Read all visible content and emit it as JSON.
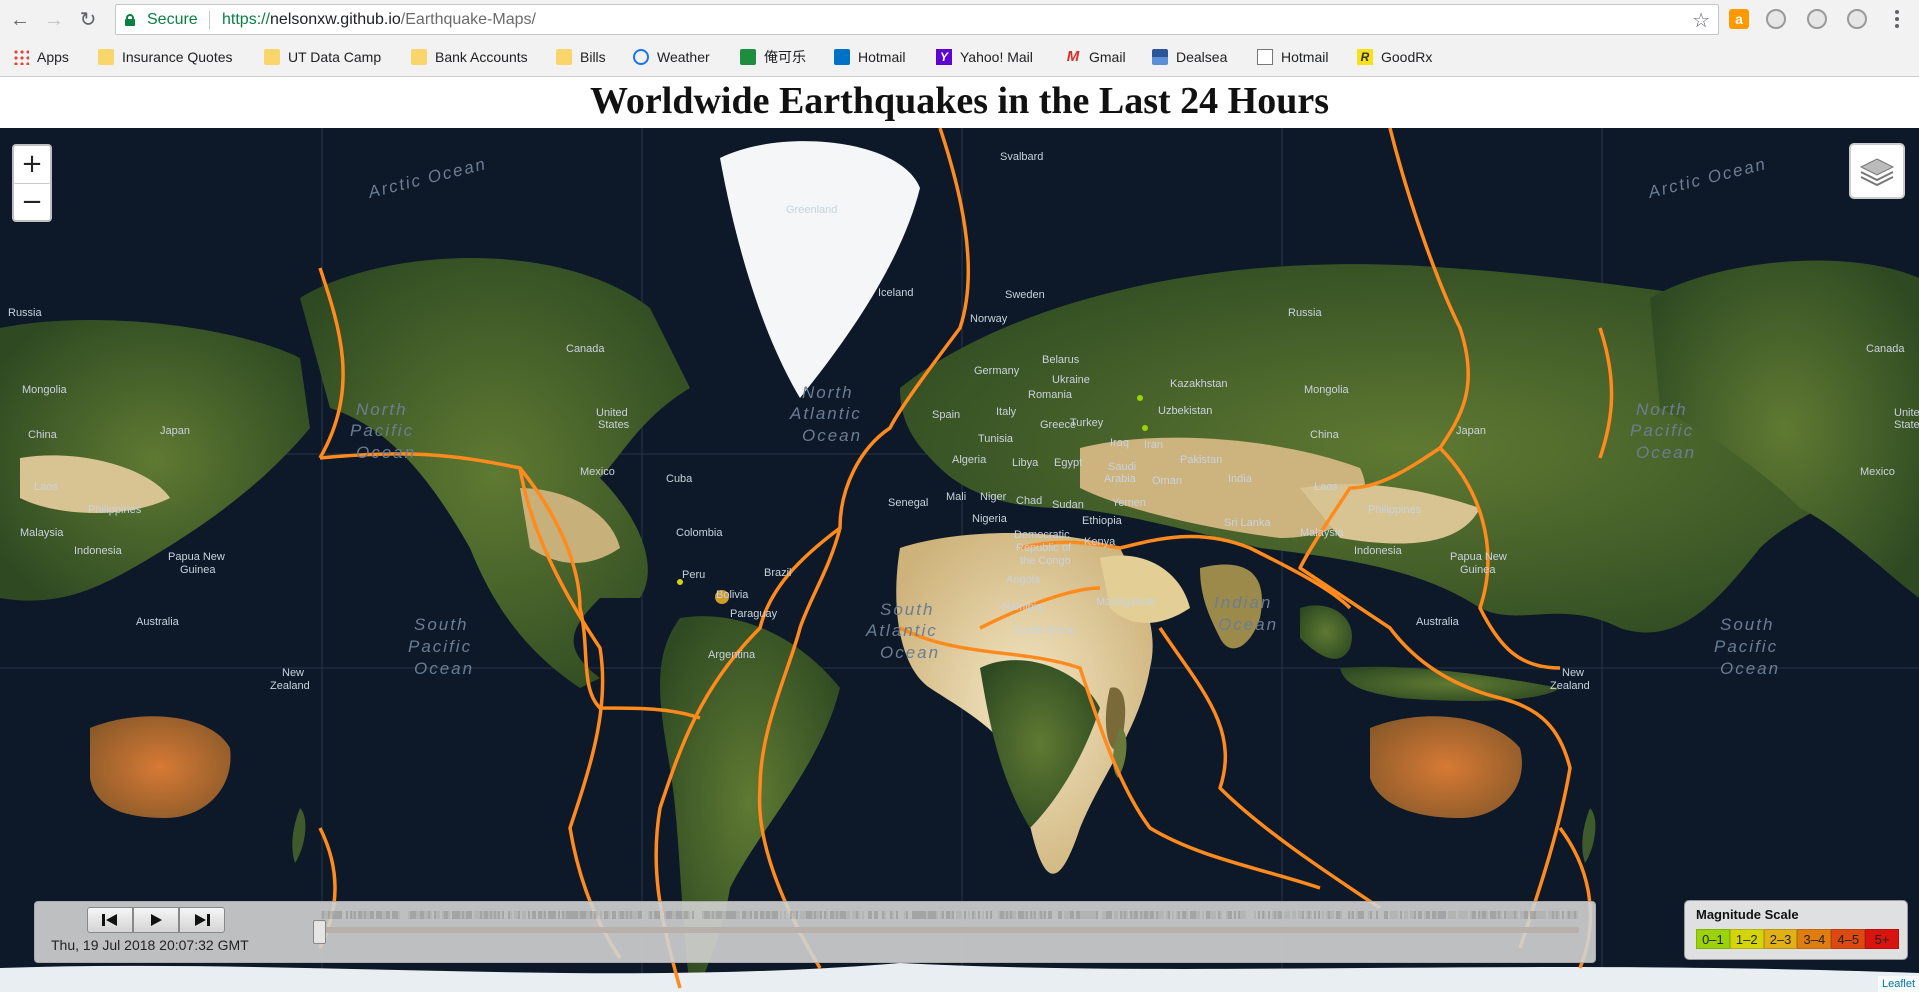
{
  "browser": {
    "secure_label": "Secure",
    "url_scheme": "https://",
    "url_host": "nelsonxw.github.io",
    "url_path": "/Earthquake-Maps/",
    "bookmarks": [
      {
        "label": "Apps",
        "icon": "apps-icon"
      },
      {
        "label": "Insurance Quotes",
        "icon": "folder-icon"
      },
      {
        "label": "UT Data Camp",
        "icon": "folder-icon"
      },
      {
        "label": "Bank Accounts",
        "icon": "folder-icon"
      },
      {
        "label": "Bills",
        "icon": "folder-icon"
      },
      {
        "label": "Weather",
        "icon": "weather-icon"
      },
      {
        "label": "俺可乐",
        "icon": "green-square-icon"
      },
      {
        "label": "Hotmail",
        "icon": "outlook-icon"
      },
      {
        "label": "Yahoo! Mail",
        "icon": "yahoo-icon"
      },
      {
        "label": "Gmail",
        "icon": "gmail-icon"
      },
      {
        "label": "Dealsea",
        "icon": "dealsea-icon"
      },
      {
        "label": "Hotmail",
        "icon": "document-icon"
      },
      {
        "label": "GoodRx",
        "icon": "goodrx-icon"
      }
    ]
  },
  "page": {
    "title": "Worldwide Earthquakes in the Last 24 Hours"
  },
  "map": {
    "zoom_in": "+",
    "zoom_out": "−",
    "ocean_labels": [
      [
        "Arctic Ocean"
      ],
      [
        "North",
        "Pacific",
        "Ocean"
      ],
      [
        "North",
        "Atlantic",
        "Ocean"
      ],
      [
        "South",
        "Pacific",
        "Ocean"
      ],
      [
        "South",
        "Atlantic",
        "Ocean"
      ],
      [
        "Indian",
        "Ocean"
      ],
      [
        "Arctic Ocean"
      ],
      [
        "North",
        "Pacific",
        "Ocean"
      ],
      [
        "South",
        "Pacific",
        "Ocean"
      ]
    ],
    "place_labels": [
      "Greenland",
      "Svalbard",
      "Iceland",
      "Sweden",
      "Norway",
      "Russia",
      "Canada",
      "Mongolia",
      "China",
      "Japan",
      "Laos",
      "Philippines",
      "Malaysia",
      "Indonesia",
      "Papua New Guinea",
      "Australia",
      "New Zealand",
      "United States",
      "Mexico",
      "Cuba",
      "Colombia",
      "Peru",
      "Brazil",
      "Bolivia",
      "Paraguay",
      "Argentina",
      "Germany",
      "Belarus",
      "Ukraine",
      "Romania",
      "Kazakhstan",
      "Uzbekistan",
      "Spain",
      "Italy",
      "Greece",
      "Turkey",
      "Iraq",
      "Iran",
      "Pakistan",
      "India",
      "Sri Lanka",
      "Tunisia",
      "Algeria",
      "Libya",
      "Egypt",
      "Saudi Arabia",
      "Yemen",
      "Oman",
      "Senegal",
      "Mali",
      "Niger",
      "Chad",
      "Sudan",
      "Nigeria",
      "Ethiopia",
      "Democratic Republic of the Congo",
      "Kenya",
      "Angola",
      "Namibia",
      "South Africa",
      "Madagascar",
      "Russia",
      "Canada",
      "United States",
      "Mexico",
      "Philippines",
      "Indonesia",
      "Papua New Guinea",
      "Australia",
      "New Zealand"
    ],
    "plate_boundary_color": "#ff8a1e",
    "quake_color": "#f0b429"
  },
  "timeline": {
    "timestamp": "Thu, 19 Jul 2018 20:07:32 GMT",
    "position": 0.0
  },
  "legend": {
    "title": "Magnitude Scale",
    "items": [
      {
        "label": "0–1",
        "color": "#9ad20b"
      },
      {
        "label": "1–2",
        "color": "#d4d40a"
      },
      {
        "label": "2–3",
        "color": "#e0b016"
      },
      {
        "label": "3–4",
        "color": "#e07d10"
      },
      {
        "label": "4–5",
        "color": "#dc4a12"
      },
      {
        "label": "5+",
        "color": "#d9140e"
      }
    ]
  },
  "attribution": "Leaflet"
}
